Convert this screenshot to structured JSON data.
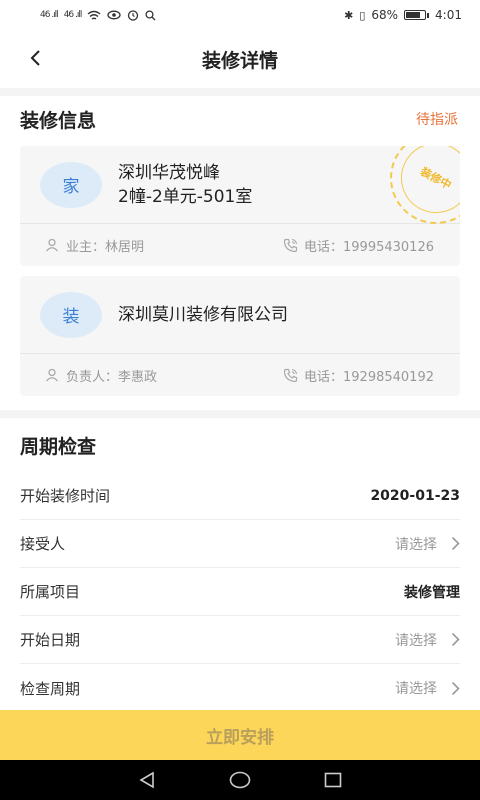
{
  "status_bar": {
    "signal1": "46 .ıll",
    "signal2": "46 .ıll",
    "battery": "68%",
    "time": "4:01"
  },
  "nav": {
    "title": "装修详情"
  },
  "decoration_info": {
    "title": "装修信息",
    "status": "待指派",
    "home_card": {
      "avatar_text": "家",
      "name_line1": "深圳华茂悦峰",
      "name_line2": "2幢-2单元-501室",
      "owner_label": "业主：林居明",
      "phone_label": "电话：19995430126",
      "stamp_text": "装修中"
    },
    "company_card": {
      "avatar_text": "装",
      "name": "深圳莫川装修有限公司",
      "manager_label": "负责人：李惠政",
      "phone_label": "电话：19298540192"
    }
  },
  "period_check": {
    "title": "周期检查",
    "rows": [
      {
        "label": "开始装修时间",
        "value": "2020-01-23"
      },
      {
        "label": "接受人",
        "value": "请选择"
      },
      {
        "label": "所属项目",
        "value": "装修管理"
      },
      {
        "label": "开始日期",
        "value": "请选择"
      },
      {
        "label": "检查周期",
        "value": "请选择"
      }
    ]
  },
  "action": {
    "label": "立即安排"
  },
  "icons": {
    "back": "chevron-left-icon",
    "user": "user-icon",
    "phone": "phone-icon",
    "chevron": "chevron-right-icon"
  }
}
